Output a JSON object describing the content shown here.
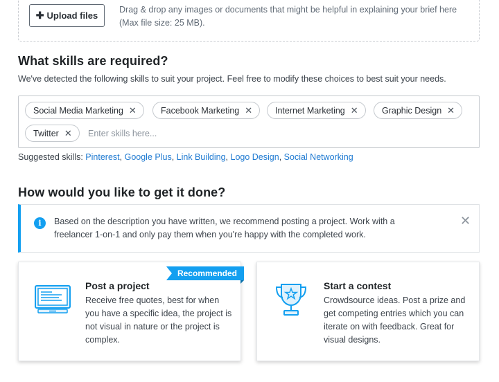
{
  "upload": {
    "button_label": "Upload files",
    "hint": "Drag & drop any images or documents that might be helpful in explaining your brief here (Max file size: 25 MB)."
  },
  "skills": {
    "heading": "What skills are required?",
    "subtext": "We've detected the following skills to suit your project. Feel free to modify these choices to best suit your needs.",
    "chips": [
      "Social Media Marketing",
      "Facebook Marketing",
      "Internet Marketing",
      "Graphic Design",
      "Twitter"
    ],
    "input_placeholder": "Enter skills here...",
    "suggested_label": "Suggested skills:",
    "suggested": [
      "Pinterest",
      "Google Plus",
      "Link Building",
      "Logo Design",
      "Social Networking"
    ]
  },
  "method": {
    "heading": "How would you like to get it done?",
    "info_text": "Based on the description you have written, we recommend posting a project. Work with a freelancer 1-on-1 and only pay them when you're happy with the completed work.",
    "cards": [
      {
        "title": "Post a project",
        "description": "Receive free quotes, best for when you have a specific idea, the project is not visual in nature or the project is complex.",
        "badge": "Recommended",
        "icon": "monitor-icon"
      },
      {
        "title": "Start a contest",
        "description": "Crowdsource ideas. Post a prize and get competing entries which you can iterate on with feedback. Great for visual designs.",
        "icon": "trophy-icon"
      }
    ]
  },
  "colors": {
    "accent": "#139ff0",
    "link": "#1f7ad1"
  }
}
